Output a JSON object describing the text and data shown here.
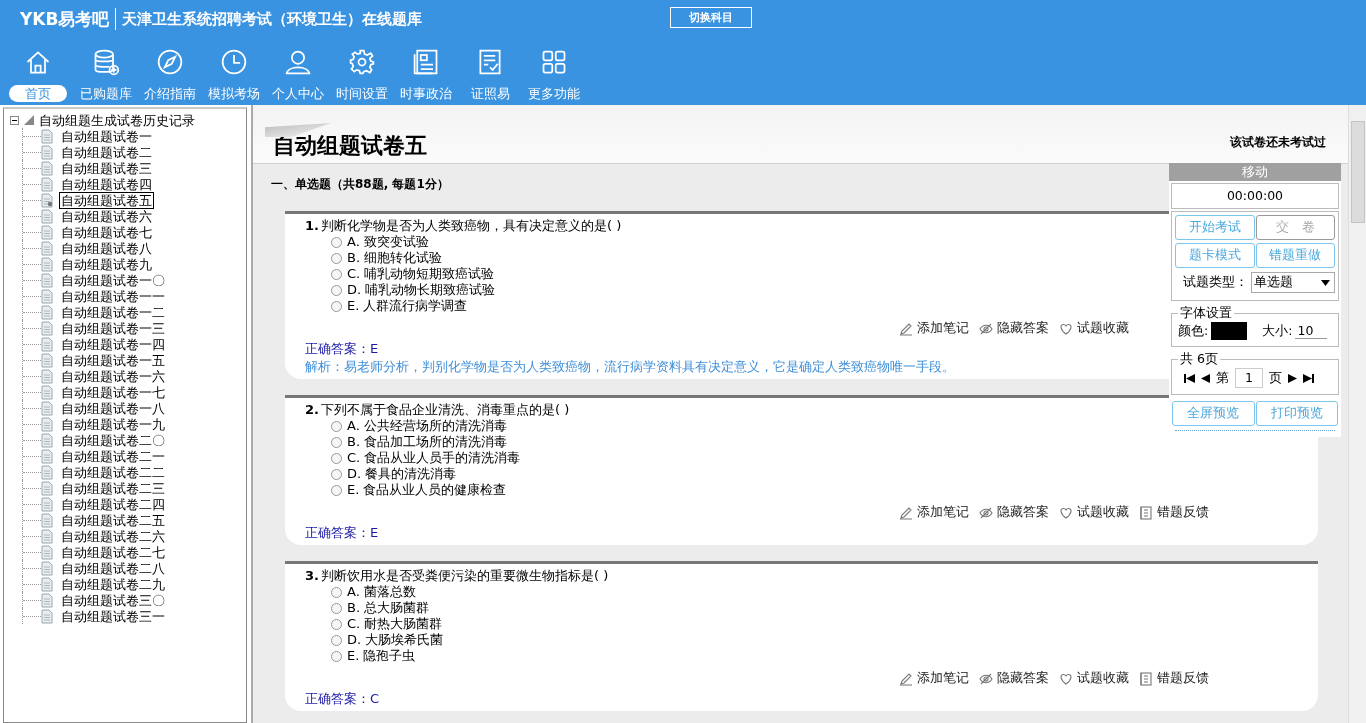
{
  "header": {
    "logo": "YKB易考吧",
    "title": "天津卫生系统招聘考试（环境卫生）在线题库",
    "switch_button": "切换科目"
  },
  "toolbar": [
    {
      "label": "首页",
      "selected": true
    },
    {
      "label": "已购题库",
      "selected": false
    },
    {
      "label": "介绍指南",
      "selected": false
    },
    {
      "label": "模拟考场",
      "selected": false
    },
    {
      "label": "个人中心",
      "selected": false
    },
    {
      "label": "时间设置",
      "selected": false
    },
    {
      "label": "时事政治",
      "selected": false
    },
    {
      "label": "证照易",
      "selected": false
    },
    {
      "label": "更多功能",
      "selected": false
    }
  ],
  "tree": {
    "label": "自动组题生成试卷历史记录",
    "expanded": true,
    "children": [
      {
        "label": "自动组题试卷一",
        "selected": false
      },
      {
        "label": "自动组题试卷二",
        "selected": false
      },
      {
        "label": "自动组题试卷三",
        "selected": false
      },
      {
        "label": "自动组题试卷四",
        "selected": false
      },
      {
        "label": "自动组题试卷五",
        "selected": true
      },
      {
        "label": "自动组题试卷六",
        "selected": false
      },
      {
        "label": "自动组题试卷七",
        "selected": false
      },
      {
        "label": "自动组题试卷八",
        "selected": false
      },
      {
        "label": "自动组题试卷九",
        "selected": false
      },
      {
        "label": "自动组题试卷一〇",
        "selected": false
      },
      {
        "label": "自动组题试卷一一",
        "selected": false
      },
      {
        "label": "自动组题试卷一二",
        "selected": false
      },
      {
        "label": "自动组题试卷一三",
        "selected": false
      },
      {
        "label": "自动组题试卷一四",
        "selected": false
      },
      {
        "label": "自动组题试卷一五",
        "selected": false
      },
      {
        "label": "自动组题试卷一六",
        "selected": false
      },
      {
        "label": "自动组题试卷一七",
        "selected": false
      },
      {
        "label": "自动组题试卷一八",
        "selected": false
      },
      {
        "label": "自动组题试卷一九",
        "selected": false
      },
      {
        "label": "自动组题试卷二〇",
        "selected": false
      },
      {
        "label": "自动组题试卷二一",
        "selected": false
      },
      {
        "label": "自动组题试卷二二",
        "selected": false
      },
      {
        "label": "自动组题试卷二三",
        "selected": false
      },
      {
        "label": "自动组题试卷二四",
        "selected": false
      },
      {
        "label": "自动组题试卷二五",
        "selected": false
      },
      {
        "label": "自动组题试卷二六",
        "selected": false
      },
      {
        "label": "自动组题试卷二七",
        "selected": false
      },
      {
        "label": "自动组题试卷二八",
        "selected": false
      },
      {
        "label": "自动组题试卷二九",
        "selected": false
      },
      {
        "label": "自动组题试卷三〇",
        "selected": false
      },
      {
        "label": "自动组题试卷三一",
        "selected": false
      }
    ]
  },
  "paper": {
    "title": "自动组题试卷五",
    "status": "该试卷还未考试过",
    "section": "一、单选题（共88题, 每题1分）",
    "questions": [
      {
        "number": "1.",
        "text": "判断化学物是否为人类致癌物，具有决定意义的是( )",
        "options": [
          {
            "label": "A. 致突变试验",
            "checked": false
          },
          {
            "label": "B. 细胞转化试验",
            "checked": false
          },
          {
            "label": "C. 哺乳动物短期致癌试验",
            "checked": false
          },
          {
            "label": "D. 哺乳动物长期致癌试验",
            "checked": false
          },
          {
            "label": "E. 人群流行病学调查",
            "checked": false
          }
        ],
        "actions": [
          "添加笔记",
          "隐藏答案",
          "试题收藏"
        ],
        "answer": "正确答案：E",
        "explanation": "解析：易老师分析，判别化学物是否为人类致癌物，流行病学资料具有决定意义，它是确定人类致癌物唯一手段。"
      },
      {
        "number": "2.",
        "text": "下列不属于食品企业清洗、消毒重点的是( )",
        "options": [
          {
            "label": "A. 公共经营场所的清洗消毒",
            "checked": false
          },
          {
            "label": "B. 食品加工场所的清洗消毒",
            "checked": false
          },
          {
            "label": "C. 食品从业人员手的清洗消毒",
            "checked": false
          },
          {
            "label": "D. 餐具的清洗消毒",
            "checked": false
          },
          {
            "label": "E. 食品从业人员的健康检查",
            "checked": false
          }
        ],
        "actions": [
          "添加笔记",
          "隐藏答案",
          "试题收藏",
          "错题反馈"
        ],
        "answer": "正确答案：E"
      },
      {
        "number": "3.",
        "text": "判断饮用水是否受粪便污染的重要微生物指标是( )",
        "options": [
          {
            "label": "A. 菌落总数",
            "checked": false
          },
          {
            "label": "B. 总大肠菌群",
            "checked": false
          },
          {
            "label": "C. 耐热大肠菌群",
            "checked": false
          },
          {
            "label": "D. 大肠埃希氏菌",
            "checked": false
          },
          {
            "label": "E. 隐孢子虫",
            "checked": false
          }
        ],
        "actions": [
          "添加笔记",
          "隐藏答案",
          "试题收藏",
          "错题反馈"
        ],
        "answer": "正确答案：C"
      }
    ]
  },
  "panel": {
    "handle": "移动",
    "timer": "00:00:00",
    "buttons": [
      {
        "label": "开始考试",
        "disabled": false
      },
      {
        "label": "交　卷",
        "disabled": true
      },
      {
        "label": "题卡模式",
        "disabled": false
      },
      {
        "label": "错题重做",
        "disabled": false
      }
    ],
    "type_label": "试题类型：",
    "type_value": "单选题",
    "font_legend": "字体设置",
    "color_label": "颜色:",
    "color": "#000000",
    "size_label": "大小:",
    "size_value": "10",
    "pager_legend": "共 6页",
    "page_prefix": "第",
    "page_value": "1",
    "page_suffix": "页",
    "bottom_buttons": [
      "全屏预览",
      "打印预览"
    ]
  }
}
